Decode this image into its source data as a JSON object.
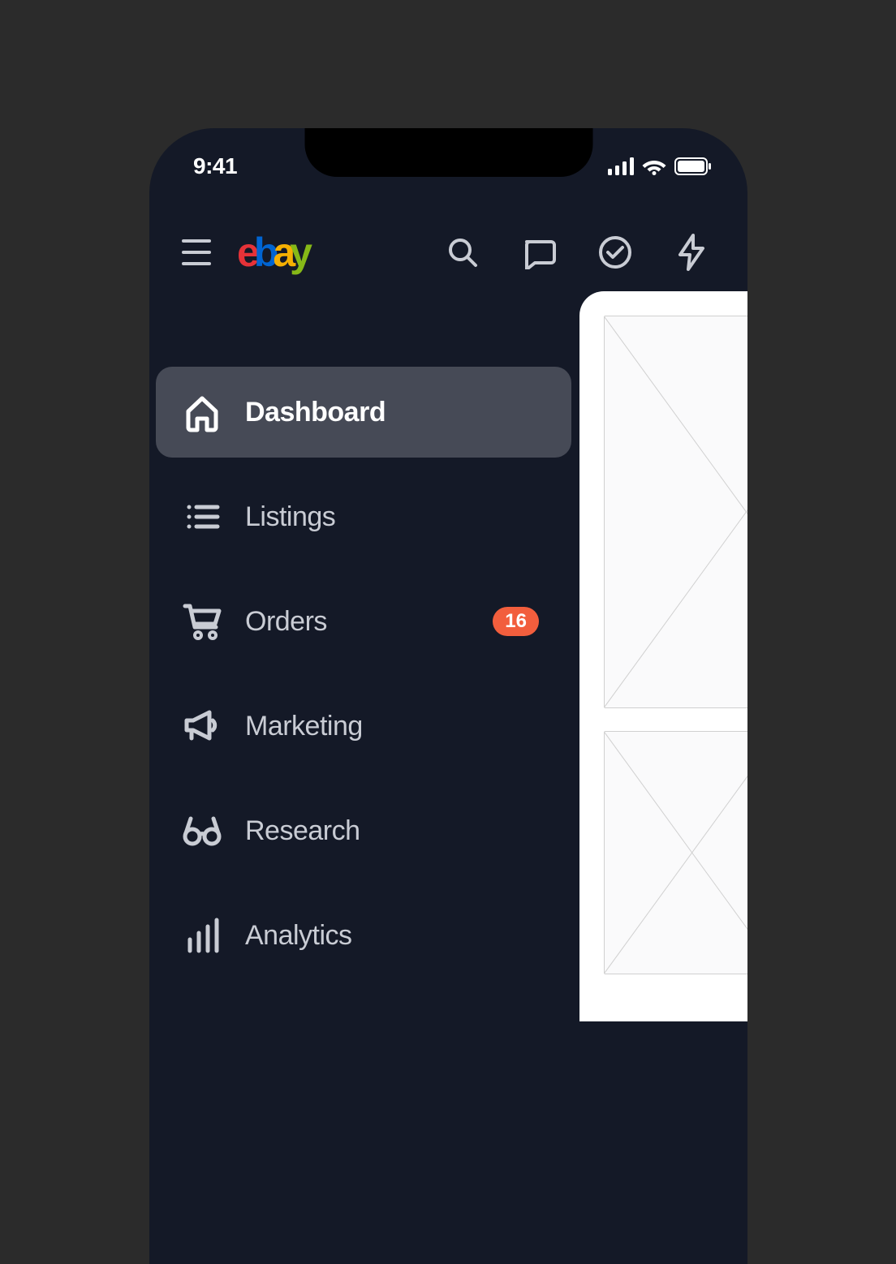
{
  "status": {
    "time": "9:41"
  },
  "logo": {
    "e": "e",
    "b": "b",
    "a": "a",
    "y": "y"
  },
  "nav": {
    "items": [
      {
        "label": "Dashboard",
        "active": true
      },
      {
        "label": "Listings"
      },
      {
        "label": "Orders",
        "badge": "16"
      },
      {
        "label": "Marketing"
      },
      {
        "label": "Research"
      },
      {
        "label": "Analytics"
      }
    ]
  }
}
